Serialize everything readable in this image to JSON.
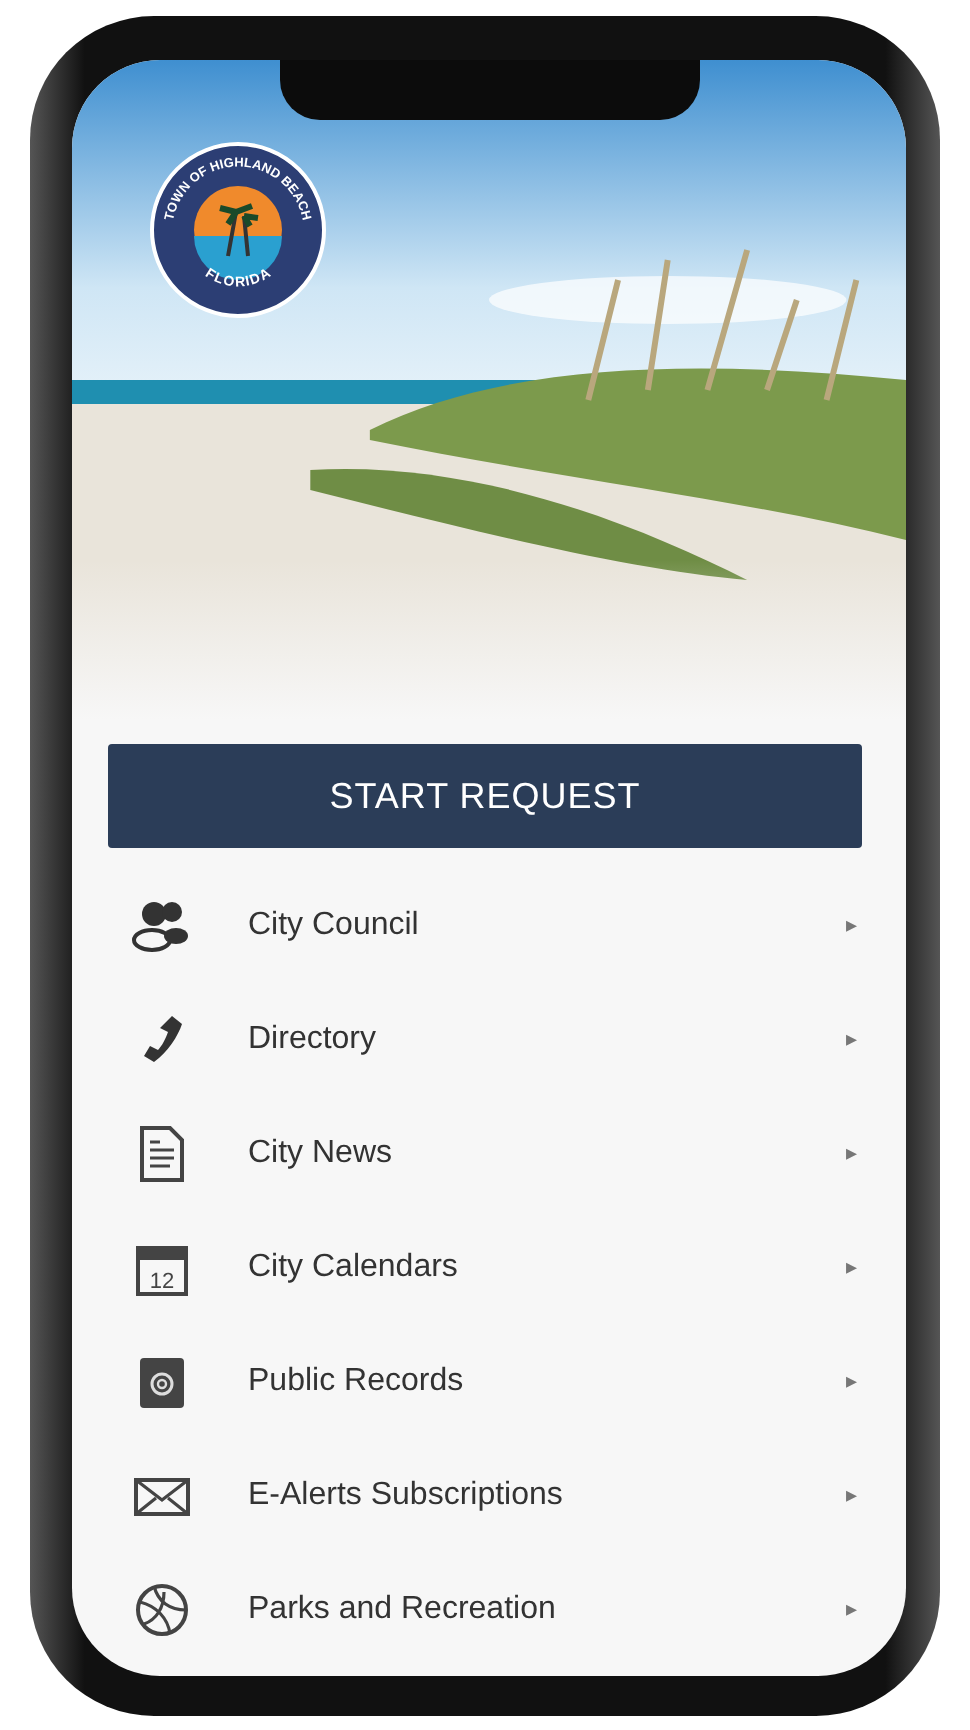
{
  "logo": {
    "top_text": "TOWN OF HIGHLAND BEACH",
    "bottom_text": "FLORIDA"
  },
  "start_button": {
    "label": "START REQUEST"
  },
  "menu": [
    {
      "label": "City Council",
      "kind": "people"
    },
    {
      "label": "Directory",
      "kind": "phone"
    },
    {
      "label": "City News",
      "kind": "document"
    },
    {
      "label": "City Calendars",
      "kind": "calendar",
      "icon_text": "12"
    },
    {
      "label": "Public Records",
      "kind": "at-book"
    },
    {
      "label": "E-Alerts Subscriptions",
      "kind": "envelope"
    },
    {
      "label": "Parks and Recreation",
      "kind": "ball"
    }
  ],
  "chevron": "▸"
}
